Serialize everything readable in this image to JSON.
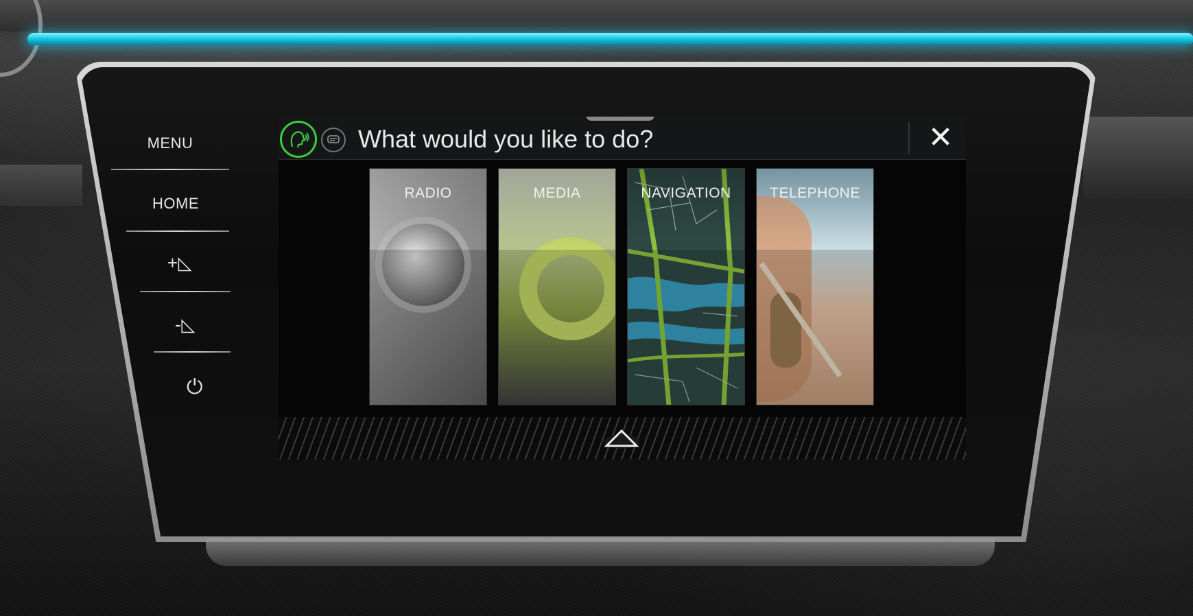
{
  "side_panel": {
    "menu_label": "MENU",
    "home_label": "HOME",
    "volume_up_glyph": "+◺",
    "volume_down_glyph": "-◺",
    "power_glyph": "⏻"
  },
  "voice_dialog": {
    "prompt": "What would you like to do?",
    "close_glyph": "✕",
    "options": [
      {
        "label": "RADIO"
      },
      {
        "label": "MEDIA"
      },
      {
        "label": "NAVIGATION"
      },
      {
        "label": "TELEPHONE"
      }
    ]
  },
  "colors": {
    "ambient_light": "#1ac9e6",
    "voice_active": "#3ccf3c",
    "text": "#e8e8e8"
  }
}
